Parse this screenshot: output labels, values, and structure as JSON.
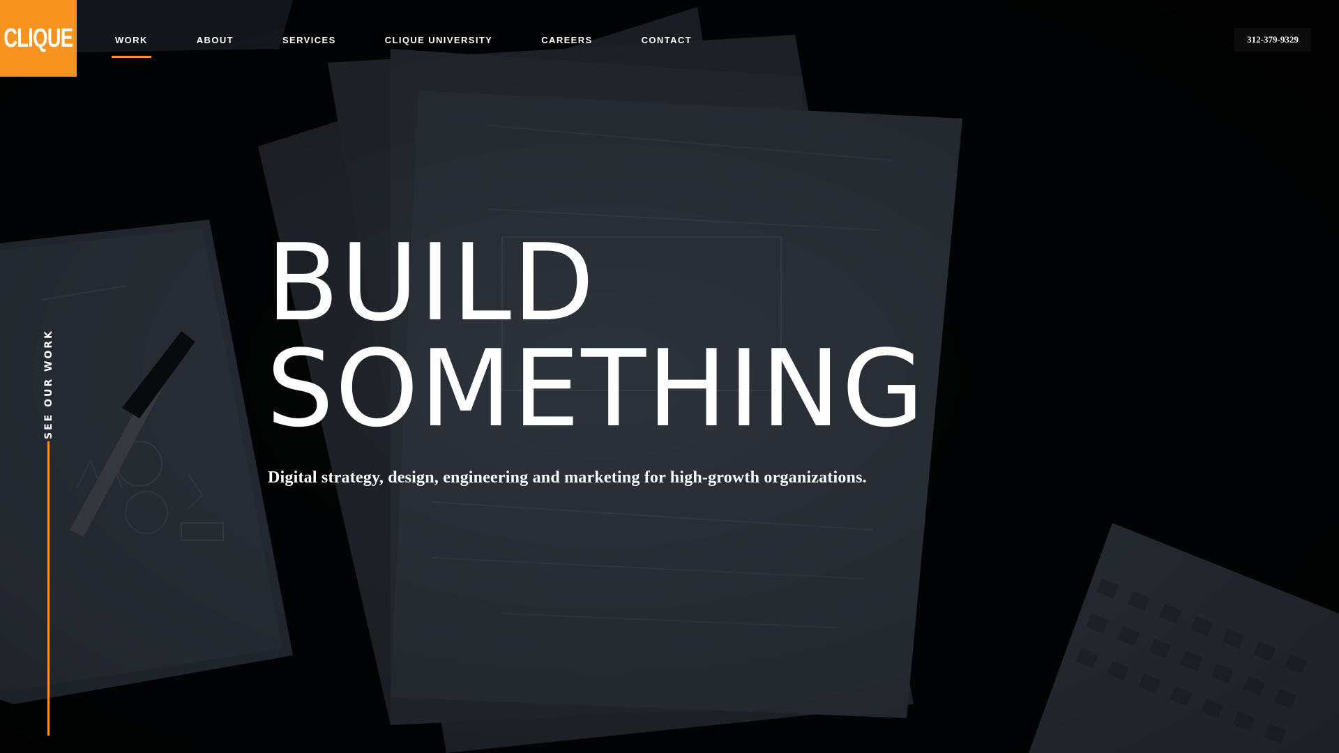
{
  "brand": {
    "logo_text": "CLIQUE",
    "accent_color": "#f7931e"
  },
  "nav": {
    "items": [
      {
        "label": "WORK",
        "active": true
      },
      {
        "label": "ABOUT",
        "active": false
      },
      {
        "label": "SERVICES",
        "active": false
      },
      {
        "label": "CLIQUE UNIVERSITY",
        "active": false
      },
      {
        "label": "CAREERS",
        "active": false
      },
      {
        "label": "CONTACT",
        "active": false
      }
    ]
  },
  "header": {
    "phone": "312-379-9329"
  },
  "side": {
    "label": "SEE OUR WORK"
  },
  "hero": {
    "title_line1": "BUILD",
    "title_line2": "SOMETHING",
    "subtitle": "Digital strategy, design, engineering and marketing for high-growth organizations."
  }
}
